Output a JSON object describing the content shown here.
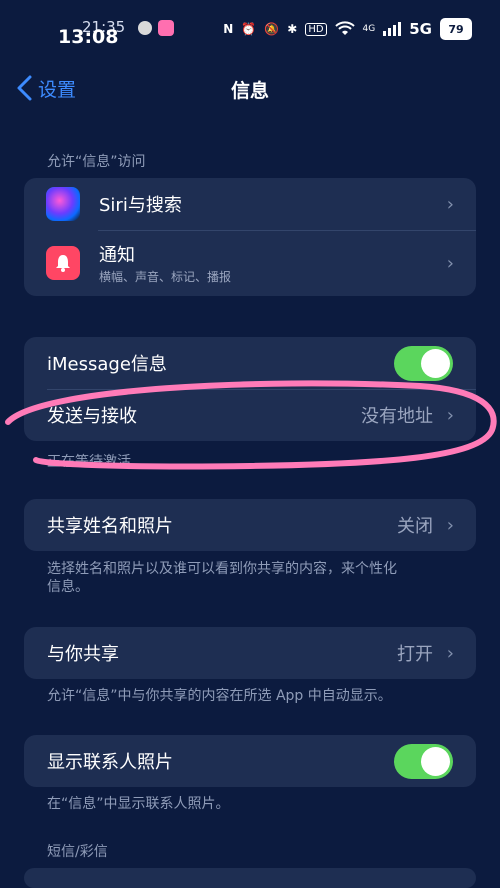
{
  "status_bar": {
    "time_ghost": "21:35",
    "time": "13:08",
    "network": "5G",
    "network_small": "5G",
    "network_4g": "4G",
    "hd": "HD",
    "battery": "79"
  },
  "nav": {
    "back_label": "设置",
    "title": "信息"
  },
  "section_access": {
    "header": "允许“信息”访问",
    "siri_label": "Siri与搜索",
    "notif_label": "通知",
    "notif_sub": "横幅、声音、标记、播报"
  },
  "section_imessage": {
    "imessage_label": "iMessage信息",
    "imessage_on": true,
    "send_receive_label": "发送与接收",
    "send_receive_value": "没有地址",
    "footnote": "正在等待激活..."
  },
  "section_share_name": {
    "label": "共享姓名和照片",
    "value": "关闭",
    "footnote": "选择姓名和照片以及谁可以看到你共享的内容，来个性化信息。"
  },
  "section_shared_with_you": {
    "label": "与你共享",
    "value": "打开",
    "footnote": "允许“信息”中与你共享的内容在所选 App 中自动显示。"
  },
  "section_contact_photos": {
    "label": "显示联系人照片",
    "on": true,
    "footnote": "在“信息”中显示联系人照片。"
  },
  "section_sms": {
    "header": "短信/彩信"
  },
  "colors": {
    "background": "#0c1b3f",
    "cell": "#1e2e52",
    "accent_blue": "#3d8bff",
    "toggle_green": "#5bd65d",
    "annotation_pink": "#ff7bb8"
  },
  "icons": [
    "back-chevron-icon",
    "siri-icon",
    "notification-bell-icon",
    "chevron-right-icon",
    "wifi-icon",
    "signal-icon",
    "battery-icon"
  ]
}
